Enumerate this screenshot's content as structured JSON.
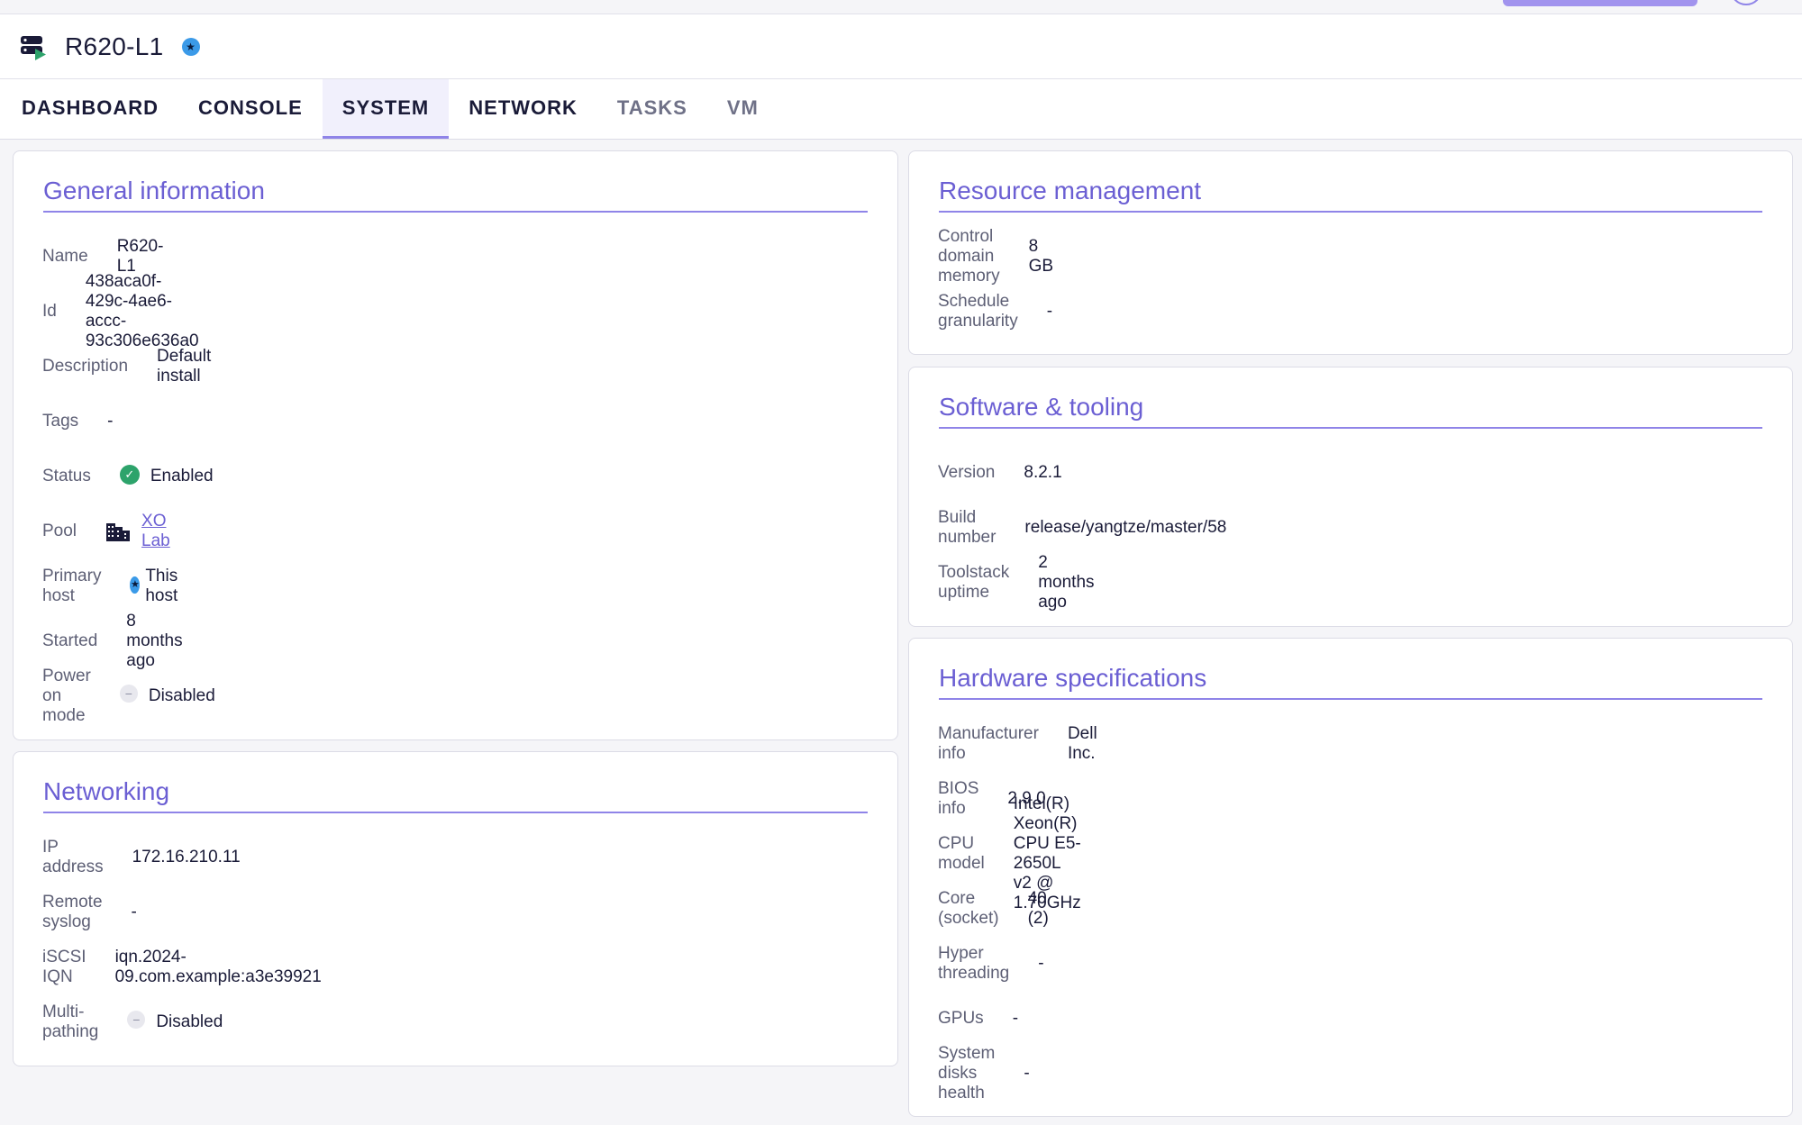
{
  "host": {
    "name": "R620-L1",
    "badge_glyph": "★"
  },
  "tabs": [
    {
      "label": "DASHBOARD"
    },
    {
      "label": "CONSOLE"
    },
    {
      "label": "SYSTEM"
    },
    {
      "label": "NETWORK"
    },
    {
      "label": "TASKS"
    },
    {
      "label": "VM"
    }
  ],
  "general": {
    "title": "General information",
    "name_label": "Name",
    "name_value": "R620-L1",
    "id_label": "Id",
    "id_value": "438aca0f-429c-4ae6-accc-93c306e636a0",
    "description_label": "Description",
    "description_value": "Default install",
    "tags_label": "Tags",
    "tags_value": "-",
    "status_label": "Status",
    "status_value": "Enabled",
    "status_glyph": "✓",
    "pool_label": "Pool",
    "pool_value": "XO Lab",
    "primary_host_label": "Primary host",
    "primary_host_value": "This host",
    "primary_host_glyph": "★",
    "started_label": "Started",
    "started_value": "8 months ago",
    "power_on_label": "Power on mode",
    "power_on_value": "Disabled",
    "disabled_glyph": "−"
  },
  "networking": {
    "title": "Networking",
    "ip_label": "IP address",
    "ip_value": "172.16.210.11",
    "syslog_label": "Remote syslog",
    "syslog_value": "-",
    "iqn_label": "iSCSI IQN",
    "iqn_value": "iqn.2024-09.com.example:a3e39921",
    "multipath_label": "Multi-pathing",
    "multipath_value": "Disabled",
    "disabled_glyph": "−"
  },
  "resource": {
    "title": "Resource management",
    "memory_label": "Control domain memory",
    "memory_value": "8 GB",
    "granularity_label": "Schedule granularity",
    "granularity_value": "-"
  },
  "software": {
    "title": "Software & tooling",
    "version_label": "Version",
    "version_value": "8.2.1",
    "build_label": "Build number",
    "build_value": "release/yangtze/master/58",
    "uptime_label": "Toolstack uptime",
    "uptime_value": "2 months ago"
  },
  "hardware": {
    "title": "Hardware specifications",
    "manufacturer_label": "Manufacturer info",
    "manufacturer_value": "Dell Inc.",
    "bios_label": "BIOS info",
    "bios_value": "2.9.0",
    "cpu_label": "CPU model",
    "cpu_value": "Intel(R) Xeon(R) CPU E5-2650L v2 @ 1.70GHz",
    "core_label": "Core (socket)",
    "core_value": "40 (2)",
    "hyper_label": "Hyper threading",
    "hyper_value": "-",
    "gpus_label": "GPUs",
    "gpus_value": "-",
    "disks_label": "System disks health",
    "disks_value": "-"
  },
  "colors": {
    "accent": "#6b5fd3",
    "accent_line": "#8f84e8",
    "success": "#2da36b",
    "badge_blue": "#3b9ae8",
    "text": "#1a1b38",
    "label": "#5d5f75"
  }
}
